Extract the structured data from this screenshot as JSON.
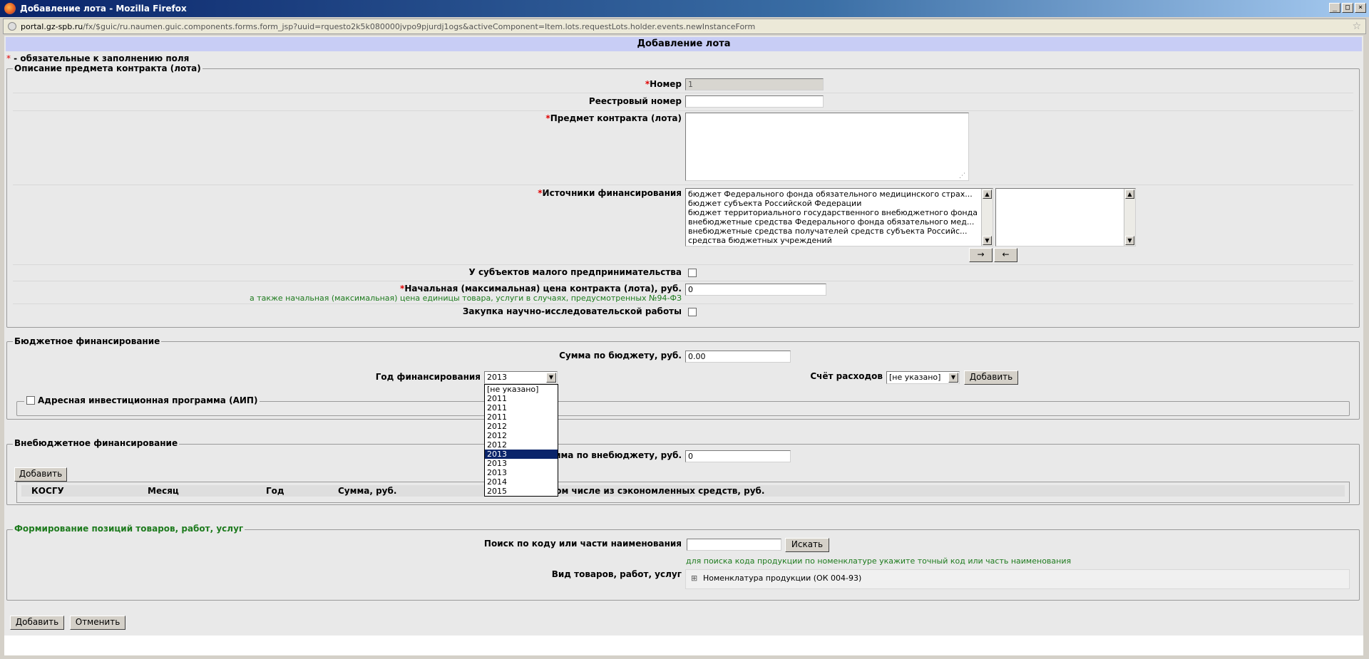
{
  "window": {
    "title": "Добавление лота - Mozilla Firefox",
    "min": "_",
    "max": "□",
    "close": "×"
  },
  "url": {
    "host": "portal.gz-spb.ru",
    "path": "/fx/$guic/ru.naumen.guic.components.forms.form_jsp?uuid=rquesto2k5k080000jvpo9pjurdj1ogs&activeComponent=Item.lots.requestLots.holder.events.newInstanceForm"
  },
  "page": {
    "title": "Добавление лота",
    "required_mark": "*",
    "required_note": " - обязательные к заполнению поля"
  },
  "lot": {
    "legend": "Описание предмета контракта (лота)",
    "number_label": "Номер",
    "number_value": "1",
    "reg_label": "Реестровый номер",
    "reg_value": "",
    "subject_label": "Предмет контракта (лота)",
    "subject_value": "",
    "sources_label": "Источники финансирования",
    "sources": [
      "бюджет Федерального фонда обязательного медицинского страх...",
      "бюджет субъекта Российской Федерации",
      "бюджет территориального государственного внебюджетного фонда",
      "внебюджетные средства Федерального фонда обязательного мед...",
      "внебюджетные средства получателей средств субъекта Российс...",
      "средства бюджетных учреждений"
    ],
    "move_right": "→",
    "move_left": "←",
    "small_business_label": "У субъектов малого предпринимательства",
    "price_label": "Начальная (максимальная) цена контракта (лота), руб.",
    "price_note": "а также начальная (максимальная) цена единицы товара, услуги в случаях, предусмотренных №94-ФЗ",
    "price_value": "0",
    "research_label": "Закупка научно-исследовательской работы"
  },
  "budget": {
    "legend": "Бюджетное финансирование",
    "sum_label": "Сумма по бюджету, руб.",
    "sum_value": "0.00",
    "year_label": "Год финансирования",
    "year_value": "2013",
    "year_options": [
      "[не указано]",
      "2011",
      "2011",
      "2011",
      "2012",
      "2012",
      "2012",
      "2013",
      "2013",
      "2013",
      "2014",
      "2015"
    ],
    "year_selected_index": 7,
    "account_label": "Счёт расходов",
    "account_value": "[не указано]",
    "add_label": "Добавить",
    "aip_label": "Адресная инвестиционная программа (АИП)"
  },
  "offbudget": {
    "legend": "Внебюджетное финансирование",
    "sum_label": "Сумма по внебюджету, руб.",
    "sum_value": "0",
    "add_label": "Добавить",
    "columns": [
      "КОСГУ",
      "Месяц",
      "Год",
      "Сумма, руб.",
      "В том числе из сэкономленных средств, руб."
    ]
  },
  "positions": {
    "legend": "Формирование позиций товаров, работ, услуг",
    "search_label": "Поиск по коду или части наименования",
    "search_value": "",
    "search_button": "Искать",
    "search_hint": "для поиска кода продукции по номенклатуре укажите точный код или часть наименования",
    "kind_label": "Вид товаров, работ, услуг",
    "tree_toggle": "⊞",
    "tree_item": "Номенклатура продукции (ОК 004-93)"
  },
  "footer": {
    "add_label": "Добавить",
    "cancel_label": "Отменить"
  }
}
